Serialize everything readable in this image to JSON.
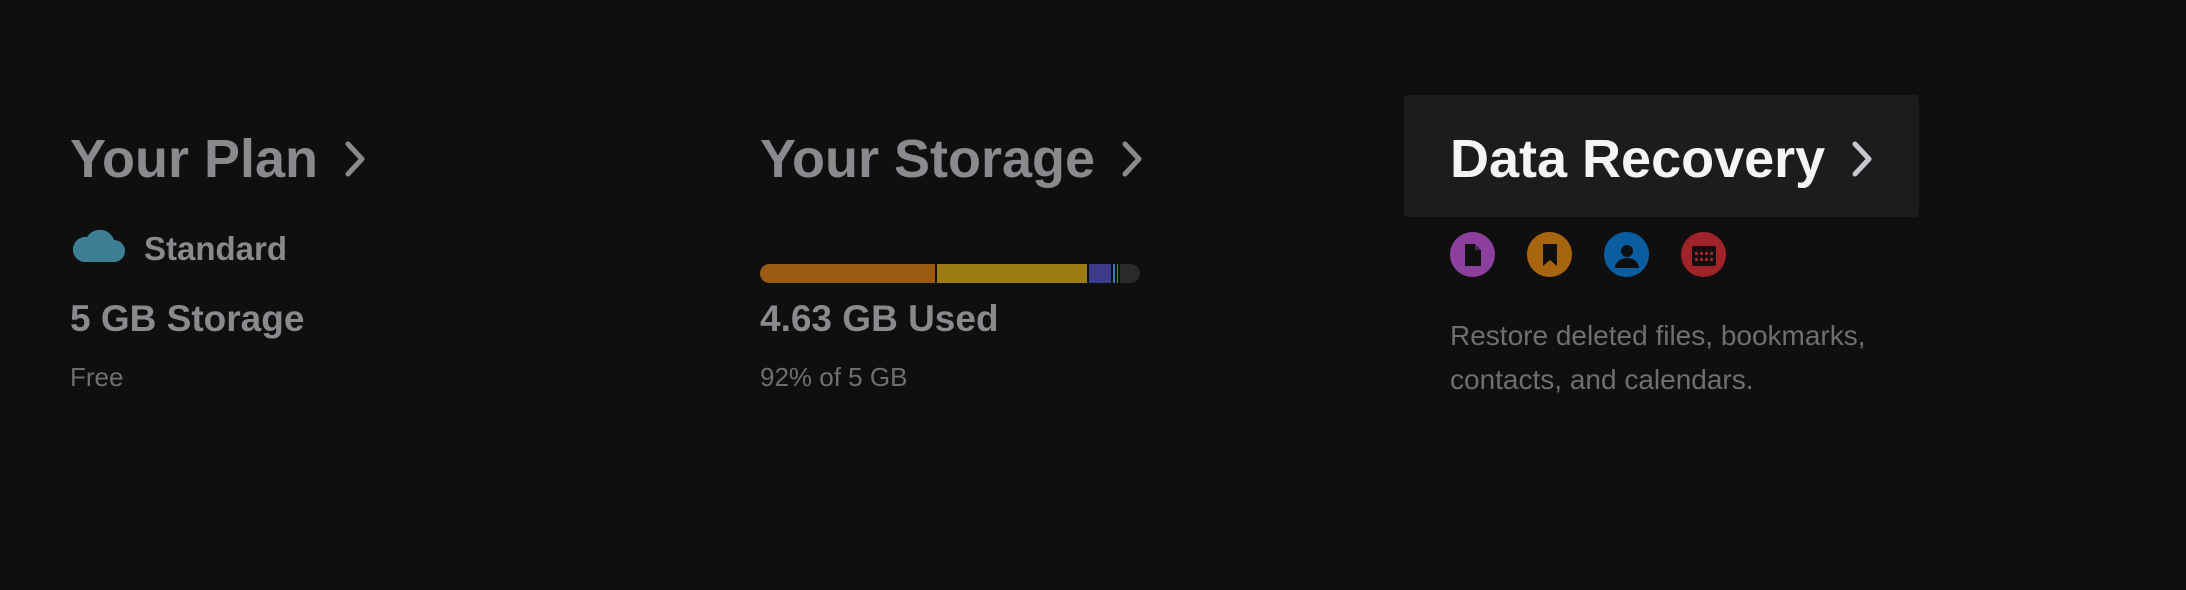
{
  "plan": {
    "title": "Your Plan",
    "tier": "Standard",
    "storage": "5 GB Storage",
    "price": "Free"
  },
  "storage": {
    "title": "Your Storage",
    "used": "4.63 GB Used",
    "percent_text": "92% of 5 GB",
    "bar_segments": [
      {
        "fraction": 0.46,
        "color": "#9a5a12"
      },
      {
        "fraction": 0.4,
        "color": "#9c7d14"
      },
      {
        "fraction": 0.065,
        "color": "#3d3c8a"
      },
      {
        "fraction": 0.008,
        "color": "#2f7ab8"
      },
      {
        "fraction": 0.008,
        "color": "#3b8f3b"
      },
      {
        "fraction": 0.006,
        "color": "#1d6aa8"
      }
    ]
  },
  "recovery": {
    "title": "Data Recovery",
    "description": "Restore deleted files, bookmarks, contacts, and calendars.",
    "icons": [
      {
        "name": "file-icon",
        "color": "#8d3f9e"
      },
      {
        "name": "bookmark-icon",
        "color": "#a8650f"
      },
      {
        "name": "contact-icon",
        "color": "#0a5ea0"
      },
      {
        "name": "calendar-icon",
        "color": "#a0232a"
      }
    ]
  },
  "colors": {
    "background": "#0f0f10",
    "cloud": "#3e7f96",
    "muted_text": "#8a8a8e",
    "highlight_text": "#f5f5f7"
  }
}
